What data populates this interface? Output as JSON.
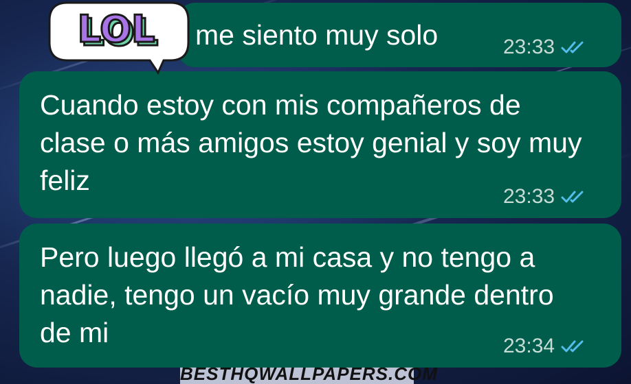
{
  "chat": {
    "messages": [
      {
        "text": "me siento muy solo",
        "time": "23:33",
        "status_icon": "double-check-read-icon"
      },
      {
        "text": "Cuando estoy con mis compañeros de clase o más amigos estoy genial y soy muy feliz",
        "time": "23:33",
        "status_icon": "double-check-read-icon"
      },
      {
        "text": "Pero luego llegó a mi casa y no tengo a nadie, tengo un vacío muy grande dentro de mi",
        "time": "23:34",
        "status_icon": "double-check-read-icon"
      }
    ]
  },
  "sticker": {
    "text": "LOL"
  },
  "wallpaper": {
    "caption": "BESTHQWALLPAPERS.COM"
  },
  "colors": {
    "bubble": "#005c4b",
    "read_ticks": "#53bdeb",
    "sticker_text": "#a974e6",
    "sticker_shadow": "#6fd3a8"
  }
}
